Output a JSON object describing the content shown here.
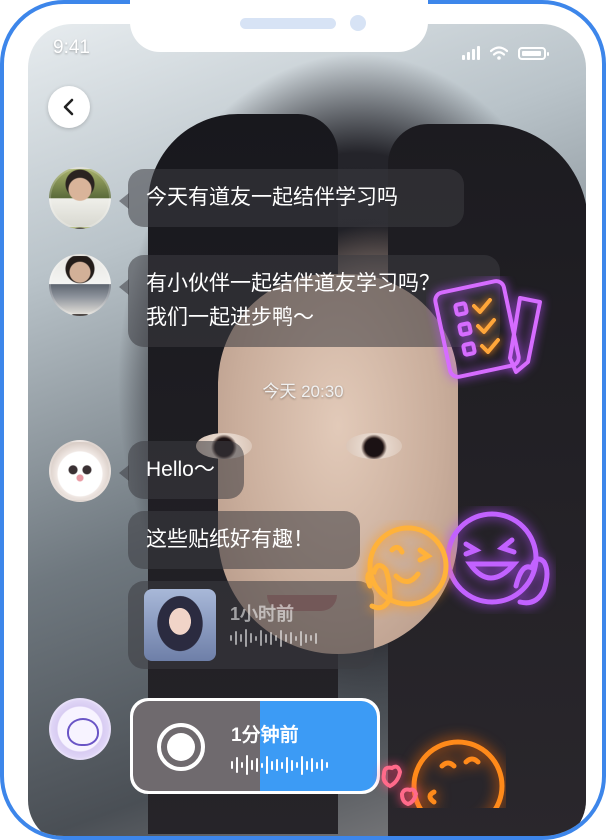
{
  "status_bar": {
    "time": "9:41"
  },
  "messages": [
    {
      "text": "今天有道友一起结伴学习吗"
    },
    {
      "text_line1": "有小伙伴一起结伴道友学习吗？",
      "text_line2": "我们一起进步鸭～"
    },
    {
      "text": "Hello～"
    },
    {
      "text": "这些贴纸好有趣！"
    }
  ],
  "date_separator": "今天 20:30",
  "voice_message": {
    "time_label": "1小时前"
  },
  "recorder": {
    "time_label": "1分钟前",
    "progress": 0.52
  },
  "icons": [
    "back-arrow-icon",
    "signal-icon",
    "wifi-icon",
    "battery-icon",
    "record-icon"
  ],
  "stickers": [
    "neon-checklist-sticker",
    "neon-laughing-emoji-sticker",
    "neon-happy-emoji-sticker",
    "neon-kiss-emoji-sticker"
  ],
  "colors": {
    "frame": "#3d86ea",
    "recorder_accent": "#3c9bf5",
    "neon_purple": "#c65cff",
    "neon_orange": "#ff9c2a"
  }
}
